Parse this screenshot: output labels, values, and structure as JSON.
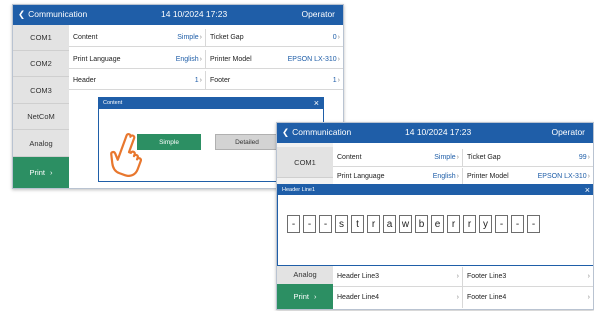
{
  "screen1": {
    "topbar": {
      "back_label": "Communication",
      "datetime": "14  10/2024 17:23",
      "role": "Operator"
    },
    "tabs": [
      {
        "label": "COM1",
        "active": false
      },
      {
        "label": "COM2",
        "active": false
      },
      {
        "label": "COM3",
        "active": false
      },
      {
        "label": "NetCoM",
        "active": false
      },
      {
        "label": "Analog",
        "active": false
      },
      {
        "label": "Print",
        "active": true
      }
    ],
    "rows": [
      {
        "left_label": "Content",
        "left_value": "Simple",
        "right_label": "Ticket Gap",
        "right_value": "0"
      },
      {
        "left_label": "Print Language",
        "left_value": "English",
        "right_label": "Printer Model",
        "right_value": "EPSON LX-310"
      },
      {
        "left_label": "Header",
        "left_value": "1",
        "right_label": "Footer",
        "right_value": "1"
      }
    ],
    "dialog": {
      "title": "Content",
      "close": "×",
      "simple_label": "Simple",
      "detailed_label": "Detailed"
    }
  },
  "screen2": {
    "topbar": {
      "back_label": "Communication",
      "datetime": "14  10/2024 17:23",
      "role": "Operator"
    },
    "tabs": [
      {
        "label": "COM1",
        "active": false
      },
      {
        "label": "Analog",
        "active": false
      },
      {
        "label": "Print",
        "active": true
      }
    ],
    "rows": [
      {
        "left_label": "Content",
        "left_value": "Simple",
        "right_label": "Ticket Gap",
        "right_value": "99"
      },
      {
        "left_label": "Print Language",
        "left_value": "English",
        "right_label": "Printer Model",
        "right_value": "EPSON LX-310"
      }
    ],
    "bottom_rows": [
      {
        "left_label": "Header Line3",
        "right_label": "Footer Line3"
      },
      {
        "left_label": "Header Line4",
        "right_label": "Footer Line4"
      }
    ],
    "dialog": {
      "title": "Header Line1",
      "close": "×",
      "chars": [
        "-",
        "-",
        "-",
        "s",
        "t",
        "r",
        "a",
        "w",
        "b",
        "e",
        "r",
        "r",
        "y",
        "-",
        "-",
        "-"
      ]
    }
  },
  "colors": {
    "topbar": "#1f5ea8",
    "active_tab": "#2c8f63",
    "value_text": "#1f5ea8",
    "hand_cursor": "#e8772e"
  },
  "icons": {
    "back": "chevron-left-icon",
    "close": "close-icon",
    "row": "chevron-right-icon",
    "cursor": "hand-pointer-icon"
  }
}
